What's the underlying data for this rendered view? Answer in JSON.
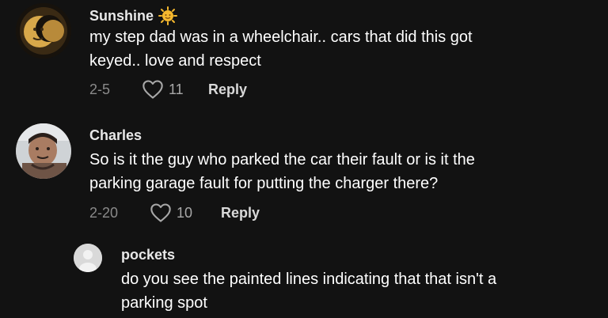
{
  "comments": [
    {
      "username": "Sunshine",
      "username_emoji": "☀",
      "lines": [
        "my step dad was in a wheelchair.. cars that did this got",
        "keyed.. love and respect"
      ],
      "date": "2-5",
      "likes": "11",
      "reply_label": "Reply"
    },
    {
      "username": "Charles",
      "lines": [
        "So is it the guy who parked the car their fault or is it the",
        "parking garage fault for putting the charger there?"
      ],
      "date": "2-20",
      "likes": "10",
      "reply_label": "Reply"
    },
    {
      "username": "pockets",
      "lines": [
        "do you see the painted lines indicating that that isn't a",
        "parking spot"
      ]
    }
  ],
  "icons": {
    "heart": "heart-outline-icon",
    "sun": "sun-emoji-icon"
  },
  "colors": {
    "background": "#121212",
    "text": "#ffffff",
    "muted": "#8a8a8a",
    "sun": "#f5b82e"
  }
}
